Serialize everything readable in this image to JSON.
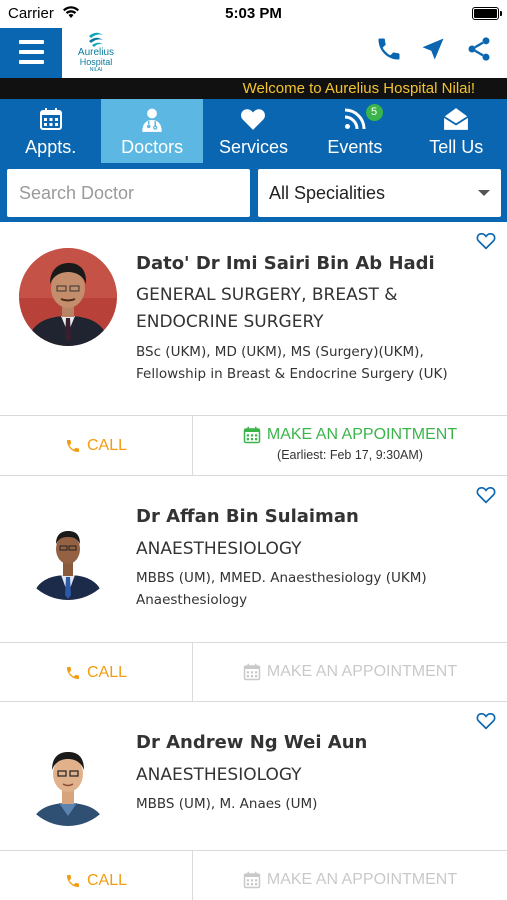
{
  "status_bar": {
    "carrier": "Carrier",
    "time": "5:03 PM"
  },
  "header": {
    "logo": {
      "line1": "Aurelius",
      "line2": "Hospital",
      "line3": "NILAI"
    },
    "actions": [
      "phone-icon",
      "location-arrow-icon",
      "share-icon"
    ]
  },
  "ticker": {
    "text": "Welcome to Aurelius Hospital Nilai!"
  },
  "tabs": [
    {
      "label": "Appts.",
      "icon": "calendar-icon"
    },
    {
      "label": "Doctors",
      "icon": "doctor-icon",
      "active": true
    },
    {
      "label": "Services",
      "icon": "heart-icon"
    },
    {
      "label": "Events",
      "icon": "rss-icon",
      "badge": "5"
    },
    {
      "label": "Tell Us",
      "icon": "envelope-open-icon"
    }
  ],
  "search": {
    "placeholder": "Search Doctor",
    "value": ""
  },
  "speciality_filter": {
    "selected": "All Specialities"
  },
  "colors": {
    "primary": "#0a66b0",
    "active_tab": "#5cb8e2",
    "ticker_text": "#f4c430",
    "call": "#f39c12",
    "appointment_enabled": "#3bb54a",
    "appointment_disabled": "#c9c9c9"
  },
  "doctors": [
    {
      "name": "Dato' Dr Imi Sairi Bin Ab Hadi",
      "speciality_line1": "GENERAL SURGERY, BREAST &",
      "speciality_line2": "ENDOCRINE SURGERY",
      "qual_line1": "BSc (UKM), MD (UKM), MS (Surgery)(UKM),",
      "qual_line2": "Fellowship in Breast & Endocrine Surgery (UK)",
      "call_label": "CALL",
      "appointment_label": "MAKE AN APPOINTMENT",
      "earliest": "(Earliest: Feb 17, 9:30AM)"
    },
    {
      "name": "Dr Affan Bin Sulaiman",
      "speciality_line1": "ANAESTHESIOLOGY",
      "qual_line1": "MBBS (UM), MMED. Anaesthesiology (UKM)",
      "qual_line2": "Anaesthesiology",
      "call_label": "CALL",
      "appointment_label": "MAKE AN APPOINTMENT"
    },
    {
      "name": "Dr Andrew Ng Wei Aun",
      "speciality_line1": "ANAESTHESIOLOGY",
      "qual_line1": "MBBS (UM), M. Anaes (UM)",
      "call_label": "CALL",
      "appointment_label": "MAKE AN APPOINTMENT"
    }
  ]
}
